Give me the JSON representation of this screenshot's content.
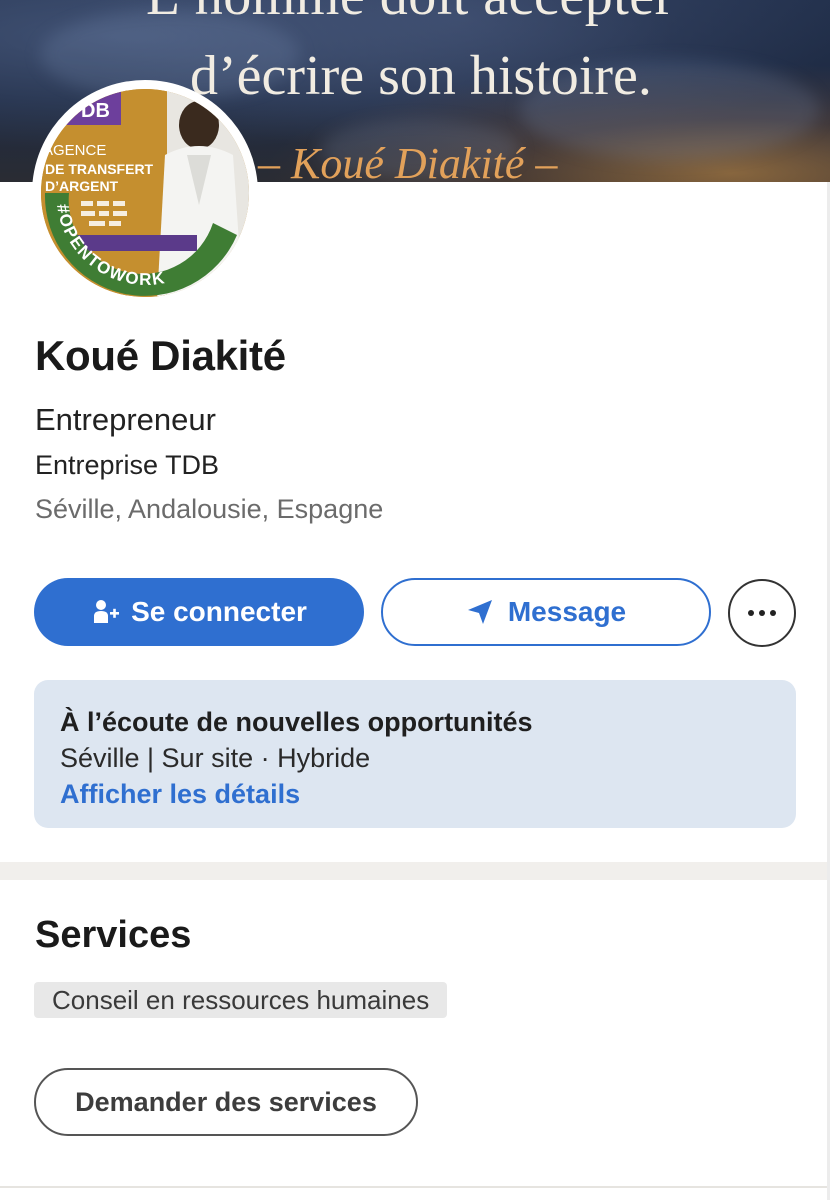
{
  "cover": {
    "quote_line1": "L’homme doit accepter",
    "quote_line2": "d’écrire son histoire.",
    "signature": "– Koué Diakité –"
  },
  "avatar": {
    "frame_text": "#OPENTOWORK",
    "photo_text_1": "AGENCE",
    "photo_text_2": "DE TRANSFERT",
    "photo_text_3": "D’ARGENT",
    "photo_logo": "DB",
    "frame_color": "#3f7d34"
  },
  "profile": {
    "name": "Koué Diakité",
    "headline": "Entrepreneur",
    "company": "Entreprise TDB",
    "location": "Séville, Andalousie, Espagne"
  },
  "actions": {
    "connect_label": "Se connecter",
    "connect_icon": "person-add-icon",
    "message_label": "Message",
    "message_icon": "send-icon",
    "more_icon": "more-icon"
  },
  "open_to_work": {
    "title": "À l’écoute de nouvelles opportunités",
    "subtitle": "Séville | Sur site · Hybride",
    "link": "Afficher les détails"
  },
  "services": {
    "title": "Services",
    "items": [
      "Conseil en ressources humaines"
    ],
    "request_label": "Demander des services"
  },
  "colors": {
    "accent": "#2f6fd0",
    "card_bg": "#dde6f1",
    "opentowork_green": "#3f7d34"
  }
}
